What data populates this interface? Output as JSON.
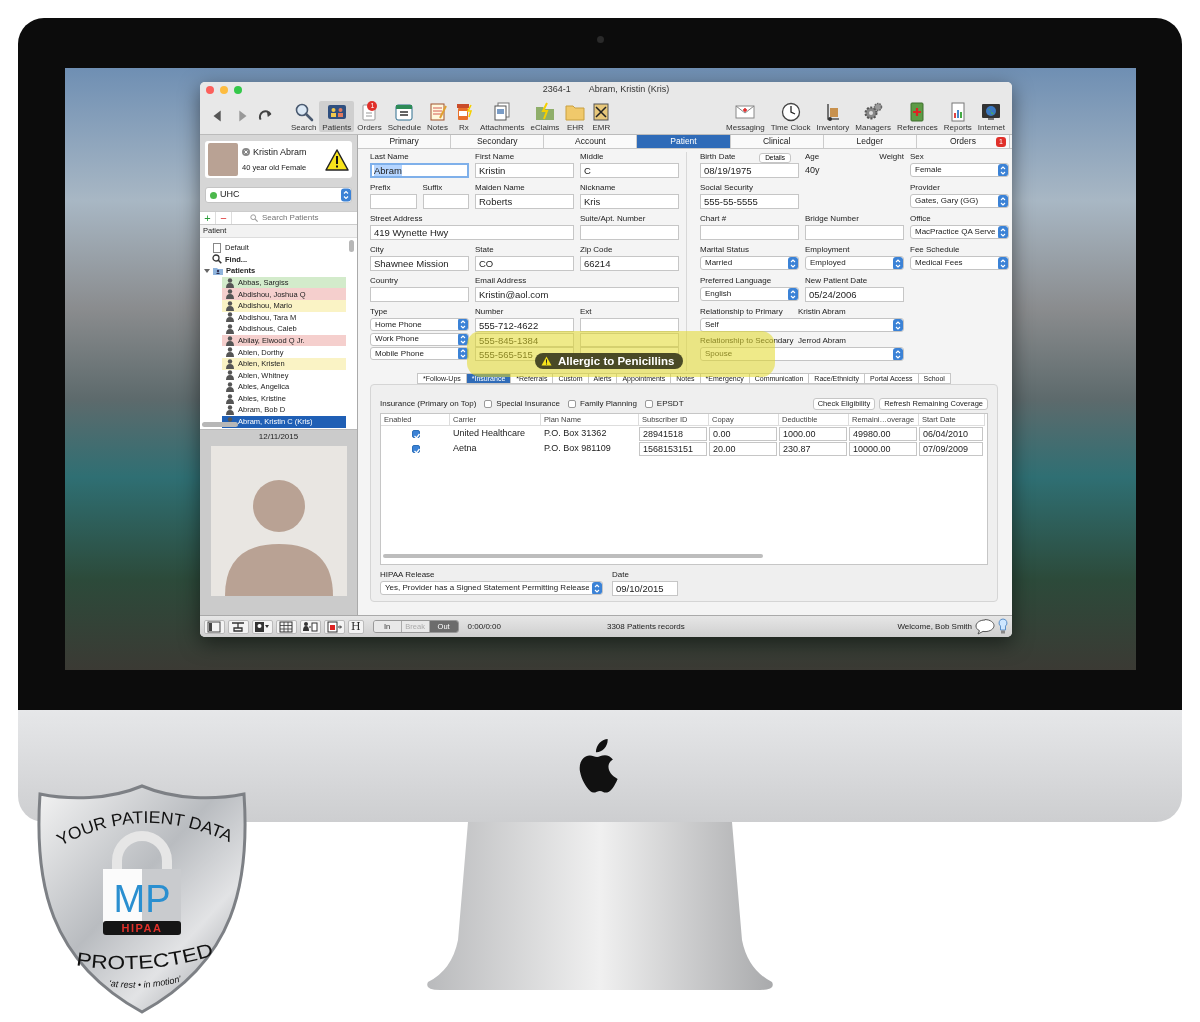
{
  "window": {
    "record_id": "2364-1",
    "title": "Abram, Kristin (Kris)"
  },
  "toolbar": {
    "left_items": [
      {
        "label": "Search",
        "selected": false
      },
      {
        "label": "Patients",
        "selected": true
      },
      {
        "label": "Orders",
        "selected": false,
        "badge": "1"
      },
      {
        "label": "Schedule",
        "selected": false
      },
      {
        "label": "Notes",
        "selected": false
      },
      {
        "label": "Rx",
        "selected": false
      },
      {
        "label": "Attachments",
        "selected": false
      },
      {
        "label": "eClaims",
        "selected": false
      },
      {
        "label": "EHR",
        "selected": false
      },
      {
        "label": "EMR",
        "selected": false
      }
    ],
    "right_items": [
      {
        "label": "Messaging",
        "selected": false
      },
      {
        "label": "Time Clock",
        "selected": false
      },
      {
        "label": "Inventory",
        "selected": false
      },
      {
        "label": "Managers",
        "selected": false
      },
      {
        "label": "References",
        "selected": false
      },
      {
        "label": "Reports",
        "selected": false
      },
      {
        "label": "Internet",
        "selected": false
      }
    ]
  },
  "sidebar": {
    "patient_card": {
      "name": "Kristin Abram",
      "description": "40 year old Female"
    },
    "insurance_select": {
      "value": "UHC"
    },
    "list_buttons": [
      "+",
      "−"
    ],
    "search": {
      "placeholder": "Search Patients"
    },
    "list_header": "Patient",
    "tree": [
      {
        "label": "Default",
        "kind": "document",
        "selected": false
      },
      {
        "label": "Find...",
        "kind": "search",
        "selected": false
      },
      {
        "label": "Patients",
        "kind": "folder",
        "selected": false,
        "expanded": true,
        "children": [
          {
            "label": "Abbas, Sargiss",
            "selected": false,
            "color": "#d3ebcb"
          },
          {
            "label": "Abdishou, Joshua Q",
            "selected": false,
            "color": "#f5cfcd"
          },
          {
            "label": "Abdishou, Mario",
            "selected": false,
            "color": "#faf3c5"
          },
          {
            "label": "Abdishou, Tara M",
            "selected": false
          },
          {
            "label": "Abdishous, Caleb",
            "selected": false
          },
          {
            "label": "Abilay, Elwood Q Jr.",
            "selected": false,
            "color": "#f5cfcd"
          },
          {
            "label": "Ablen, Dorthy",
            "selected": false
          },
          {
            "label": "Ablen, Kristen",
            "selected": false,
            "color": "#faf3c5"
          },
          {
            "label": "Ablen, Whitney",
            "selected": false
          },
          {
            "label": "Ables, Angelica",
            "selected": false
          },
          {
            "label": "Ables, Kristine",
            "selected": false
          },
          {
            "label": "Abram, Bob D",
            "selected": false
          },
          {
            "label": "Abram, Kristin C (Kris)",
            "selected": true
          }
        ]
      }
    ],
    "date": "12/11/2015"
  },
  "main_tabs": [
    {
      "label": "Primary",
      "selected": false
    },
    {
      "label": "Secondary",
      "selected": false
    },
    {
      "label": "Account",
      "selected": false
    },
    {
      "label": "Patient",
      "selected": true
    },
    {
      "label": "Clinical",
      "selected": false
    },
    {
      "label": "Ledger",
      "selected": false
    },
    {
      "label": "Orders",
      "selected": false,
      "badge": "1"
    }
  ],
  "patient_form": {
    "name_fields": [
      {
        "label": "Last Name",
        "value": "Abram",
        "focused": true
      },
      {
        "label": "First Name",
        "value": "Kristin",
        "focused": false
      },
      {
        "label": "Middle",
        "value": "C",
        "focused": false
      },
      {
        "label": "Prefix",
        "focused": false
      },
      {
        "label": "Suffix",
        "focused": false
      },
      {
        "label": "Maiden Name",
        "value": "Roberts",
        "focused": false
      },
      {
        "label": "Nickname",
        "value": "Kris",
        "focused": false
      },
      {
        "label": "Street Address",
        "value": "419 Wynette Hwy",
        "focused": false
      },
      {
        "label": "Suite/Apt. Number",
        "focused": false
      },
      {
        "label": "City",
        "value": "Shawnee Mission",
        "focused": false
      },
      {
        "label": "State",
        "value": "CO",
        "focused": false
      },
      {
        "label": "Zip Code",
        "value": "66214",
        "focused": false
      },
      {
        "label": "Country",
        "focused": false
      },
      {
        "label": "Email Address",
        "value": "Kristin@aol.com",
        "focused": false
      }
    ],
    "phone_headers": [
      "Type",
      "Number",
      "Ext"
    ],
    "phones": [
      {
        "type": "Home Phone",
        "number": "555-712-4622"
      },
      {
        "type": "Work Phone",
        "number": "555-845-1384"
      },
      {
        "type": "Mobile Phone",
        "number": "555-565-515"
      }
    ],
    "detail_fields": [
      {
        "label": "Birth Date",
        "kind": "text",
        "value": "08/19/1975",
        "button": "Details"
      },
      {
        "label": "Age",
        "kind": "static",
        "value": "40y"
      },
      {
        "label": "Weight",
        "kind": "static"
      },
      {
        "label": "Sex",
        "kind": "select",
        "value": "Female"
      },
      {
        "label": "Social Security",
        "kind": "text",
        "value": "555-55-5555"
      },
      {
        "label": "Provider",
        "kind": "select",
        "value": "Gates, Gary (GG)"
      },
      {
        "label": "Chart #",
        "kind": "text"
      },
      {
        "label": "Bridge Number",
        "kind": "text"
      },
      {
        "label": "Office",
        "kind": "select",
        "value": "MacPractice QA Serve"
      },
      {
        "label": "Marital Status",
        "kind": "select",
        "value": "Married"
      },
      {
        "label": "Employment",
        "kind": "select",
        "value": "Employed"
      },
      {
        "label": "Fee Schedule",
        "kind": "select",
        "value": "Medical Fees"
      },
      {
        "label": "Preferred Language",
        "kind": "select",
        "value": "English"
      },
      {
        "label": "New Patient Date",
        "kind": "text",
        "value": "05/24/2006"
      },
      {
        "label": "Relationship to Primary",
        "kind": "select",
        "value": "Self",
        "person": "Kristin Abram"
      },
      {
        "label": "Relationship to Secondary",
        "kind": "select",
        "value": "Spouse",
        "person": "Jerrod Abram"
      }
    ]
  },
  "alert": {
    "text": "Allergic to Penicillins"
  },
  "sub_tabs": [
    {
      "label": "*Follow-Ups",
      "selected": false
    },
    {
      "label": "*Insurance",
      "selected": true
    },
    {
      "label": "*Referrals",
      "selected": false
    },
    {
      "label": "Custom",
      "selected": false
    },
    {
      "label": "Alerts",
      "selected": false
    },
    {
      "label": "Appointments",
      "selected": false
    },
    {
      "label": "Notes",
      "selected": false
    },
    {
      "label": "*Emergency",
      "selected": false
    },
    {
      "label": "Communication",
      "selected": false
    },
    {
      "label": "Race/Ethnicity",
      "selected": false
    },
    {
      "label": "Portal Access",
      "selected": false
    },
    {
      "label": "School",
      "selected": false
    }
  ],
  "insurance": {
    "title": "Insurance (Primary on Top)",
    "options": [
      {
        "label": "Special Insurance",
        "checked": false
      },
      {
        "label": "Family Planning",
        "checked": false
      },
      {
        "label": "EPSDT",
        "checked": false
      }
    ],
    "buttons": [
      "Check Eligibility",
      "Refresh Remaining Coverage"
    ],
    "table": {
      "checkbox_column": "Enabled",
      "columns": [
        "Carrier",
        "Plan Name",
        "Subscriber ID",
        "Copay",
        "Deductible",
        "Remaini…overage",
        "Start Date"
      ],
      "rows": [
        {
          "enabled": true,
          "cells": [
            "United Healthcare",
            "P.O. Box 31362",
            "28941518",
            "0.00",
            "1000.00",
            "49980.00",
            "06/04/2010"
          ]
        },
        {
          "enabled": true,
          "cells": [
            "Aetna",
            "P.O. Box 981109",
            "1568153151",
            "20.00",
            "230.87",
            "10000.00",
            "07/09/2009"
          ]
        }
      ]
    },
    "hipaa": {
      "label": "HIPAA Release",
      "value": "Yes, Provider has a Signed Statement Permitting Release",
      "date_label": "Date",
      "date": "09/10/2015"
    }
  },
  "status_bar": {
    "text_tool": "H",
    "time_clock": [
      {
        "label": "In",
        "selected": false,
        "disabled": false
      },
      {
        "label": "Break",
        "selected": false,
        "disabled": true
      },
      {
        "label": "Out",
        "selected": true,
        "disabled": false
      }
    ],
    "time": "0:00/0:00",
    "records": "3308 Patients records",
    "welcome": "Welcome, Bob Smith"
  },
  "badge": {
    "heading": "YOUR PATIENT DATA",
    "logo": "MP",
    "band": "HIPAA",
    "status": "PROTECTED",
    "tagline": "‘at rest • in motion’"
  }
}
